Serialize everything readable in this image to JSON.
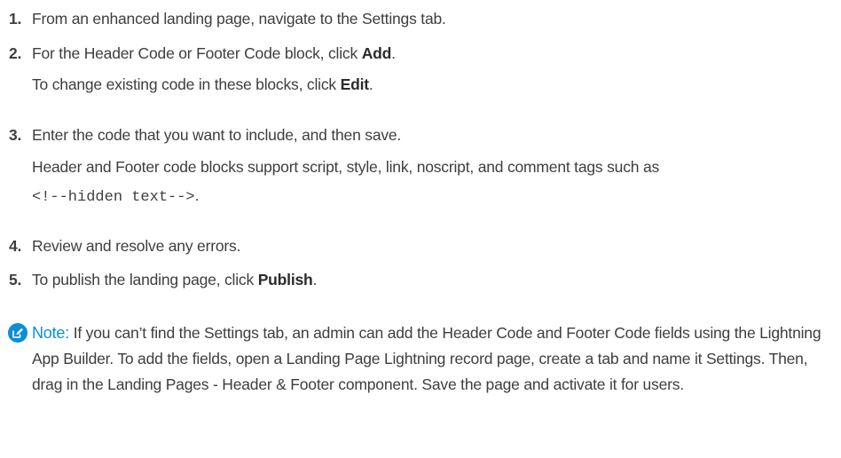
{
  "steps": [
    {
      "num": "1.",
      "text": "From an enhanced landing page, navigate to the Settings tab."
    },
    {
      "num": "2.",
      "before": "For the Header Code or Footer Code block, click ",
      "bold": "Add",
      "after": "."
    },
    {
      "num": "3.",
      "text": "Enter the code that you want to include, and then save."
    },
    {
      "num": "4.",
      "text": "Review and resolve any errors."
    },
    {
      "num": "5.",
      "before": "To publish the landing page, click ",
      "bold": "Publish",
      "after": "."
    }
  ],
  "step2_sub": {
    "before": "To change existing code in these blocks, click ",
    "bold": "Edit",
    "after": "."
  },
  "step3_sub": {
    "line1": "Header and Footer code blocks support script, style, link, noscript, and comment tags such as",
    "code": "<!--hidden text-->",
    "after": "."
  },
  "note": {
    "label": "Note:",
    "text": " If you can’t find the Settings tab, an admin can add the Header Code and Footer Code fields using the Lightning App Builder. To add the fields, open a Landing Page Lightning record page, create a tab and name it Settings. Then, drag in the Landing Pages - Header & Footer component. Save the page and activate it for users."
  },
  "colors": {
    "accent": "#0b8ed8",
    "text": "#3e3e3c"
  }
}
